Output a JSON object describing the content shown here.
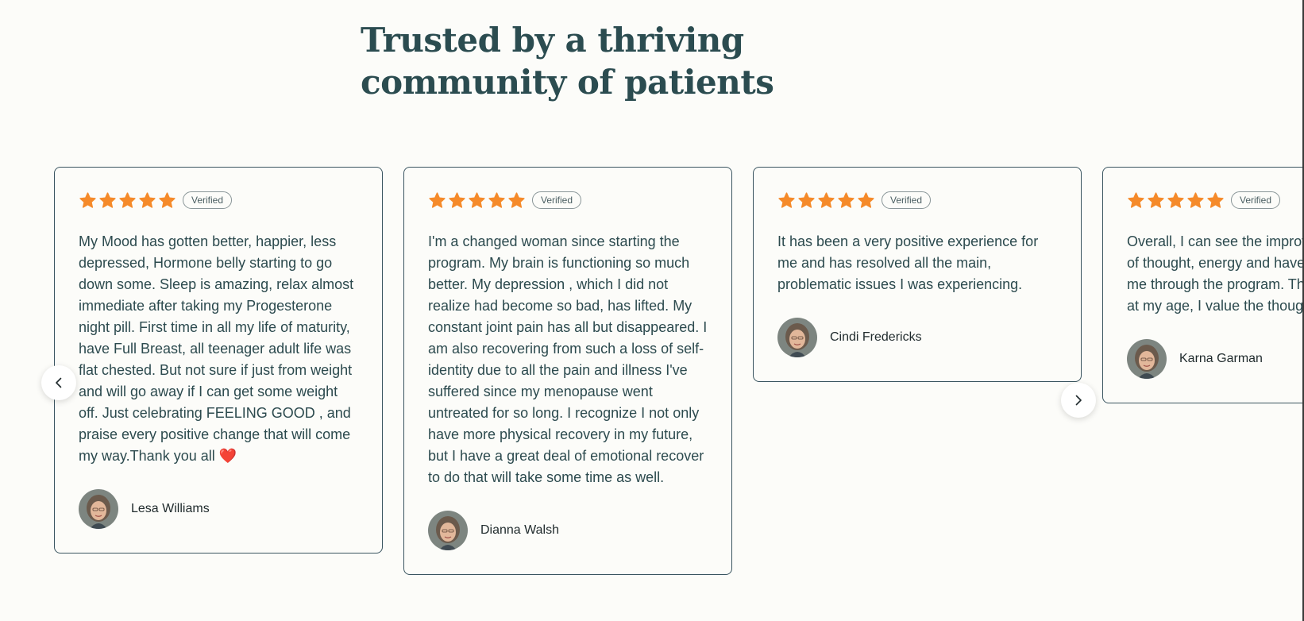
{
  "section": {
    "title_line1": "Trusted by a thriving",
    "title_line2": "community of patients"
  },
  "colors": {
    "star": "#f58a2a",
    "heading": "#2b4c50",
    "border": "#3a5560"
  },
  "reviews": [
    {
      "rating": 5,
      "badge": "Verified",
      "text": "My Mood has gotten better, happier, less depressed, Hormone belly starting to go down some. Sleep is amazing, relax almost immediate after taking my Progesterone night pill. First time in all my life of maturity, have Full Breast, all teenager adult life was flat chested. But not sure if just from weight and will go away if I can get some weight off. Just celebrating FEELING GOOD , and praise every positive change that will come my way.Thank you all",
      "emoji": "❤️",
      "author": "Lesa Williams"
    },
    {
      "rating": 5,
      "badge": "Verified",
      "text": "I'm a changed woman since starting the program. My brain is functioning so much better. My depression , which I did not realize had become so bad, has lifted. My constant joint pain has all but disappeared. I am also recovering from such a loss of self-identity due to all the pain and illness I've suffered since my menopause went untreated for so long. I recognize I not only have more physical recovery in my future, but I have a great deal of emotional recover to do that will take some time as well.",
      "author": "Dianna Walsh"
    },
    {
      "rating": 5,
      "badge": "Verified",
      "text": "It has been a very positive experience for me and has resolved all the main, problematic issues I was experiencing.",
      "author": "Cindi Fredericks"
    },
    {
      "rating": 5,
      "badge": "Verified",
      "text": "Overall, I can see the improvement in clarity of thought, energy and have been KEY for me through the program. The other benefits at my age, I value the thought, sleep most :)",
      "author": "Karna Garman"
    }
  ],
  "carousel": {
    "prev_icon": "chevron-left-icon",
    "next_icon": "chevron-right-icon"
  }
}
